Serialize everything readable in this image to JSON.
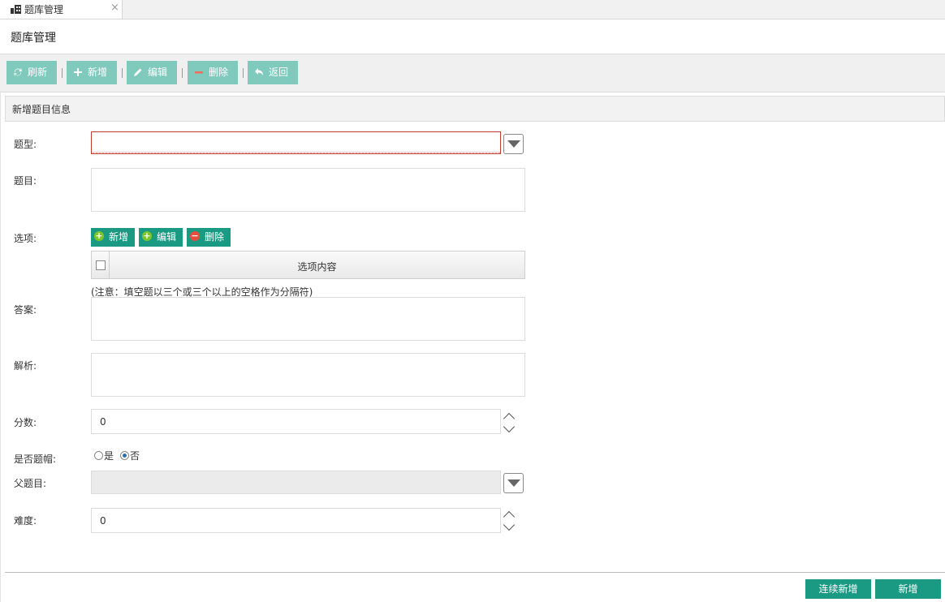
{
  "tab": {
    "label": "题库管理",
    "close": "×",
    "icon": "grid-icon"
  },
  "page": {
    "title": "题库管理"
  },
  "toolbar": {
    "refresh": "刷新",
    "add": "新增",
    "edit": "编辑",
    "delete": "删除",
    "back": "返回",
    "color": "#80c9bd"
  },
  "section": {
    "title": "新增题目信息"
  },
  "form": {
    "type_label": "题型:",
    "type_value": "",
    "question_label": "题目:",
    "question_value": "",
    "options_label": "选项:",
    "options_buttons": {
      "add": "新增",
      "edit": "编辑",
      "delete": "删除"
    },
    "options_column": "选项内容",
    "answer_note": "(注意：填空题以三个或三个以上的空格作为分隔符)",
    "answer_label": "答案:",
    "answer_value": "",
    "analysis_label": "解析:",
    "analysis_value": "",
    "score_label": "分数:",
    "score_value": "0",
    "is_parent_label": "是否题帽:",
    "is_parent_yes": "是",
    "is_parent_no": "否",
    "is_parent_selected": "否",
    "parent_label": "父题目:",
    "parent_value": "",
    "difficulty_label": "难度:",
    "difficulty_value": "0"
  },
  "footer": {
    "continue_add": "连续新增",
    "add": "新增",
    "color": "#1a9a83"
  }
}
